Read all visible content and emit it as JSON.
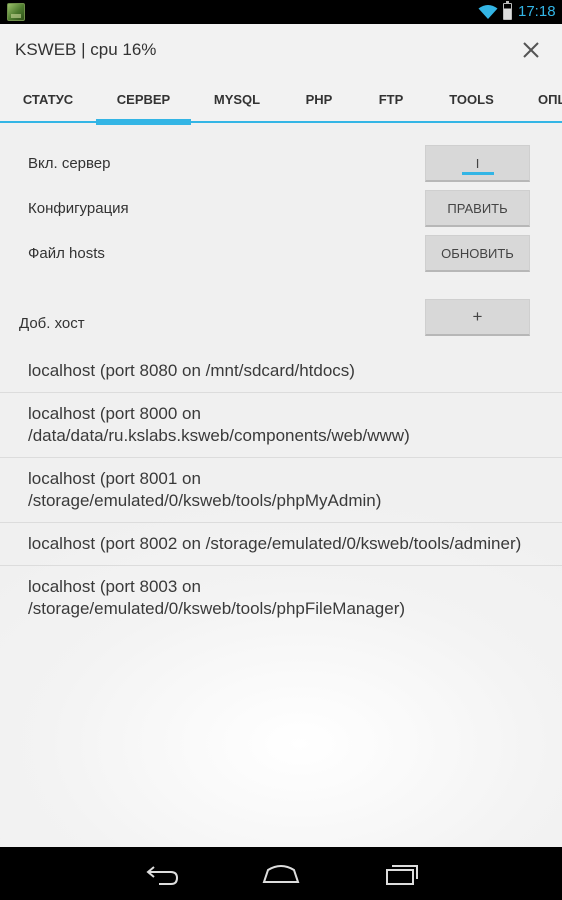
{
  "status_bar": {
    "time": "17:18",
    "accent": "#33b5e5"
  },
  "app_bar": {
    "title": "KSWEB | cpu 16%",
    "close_icon": "close-icon"
  },
  "tabs": [
    {
      "label": "СТАТУС",
      "active": false
    },
    {
      "label": "СЕРВЕР",
      "active": true
    },
    {
      "label": "MYSQL",
      "active": false
    },
    {
      "label": "PHP",
      "active": false
    },
    {
      "label": "FTP",
      "active": false
    },
    {
      "label": "TOOLS",
      "active": false
    },
    {
      "label": "ОПЦ",
      "active": false
    }
  ],
  "server": {
    "enable_label": "Вкл. сервер",
    "enable_button": "I",
    "config_label": "Конфигурация",
    "config_button": "ПРАВИТЬ",
    "hosts_label": "Файл hosts",
    "hosts_button": "ОБНОВИТЬ",
    "add_host_label": "Доб. хост",
    "add_host_button": "+"
  },
  "hosts": [
    "localhost (port 8080 on /mnt/sdcard/htdocs)",
    "localhost (port 8000 on /data/data/ru.kslabs.ksweb/components/web/www)",
    "localhost (port 8001 on /storage/emulated/0/ksweb/tools/phpMyAdmin)",
    "localhost (port 8002 on /storage/emulated/0/ksweb/tools/adminer)",
    "localhost (port 8003 on /storage/emulated/0/ksweb/tools/phpFileManager)"
  ],
  "nav_bar": {
    "icons": [
      "back-icon",
      "home-icon",
      "recent-apps-icon"
    ]
  }
}
